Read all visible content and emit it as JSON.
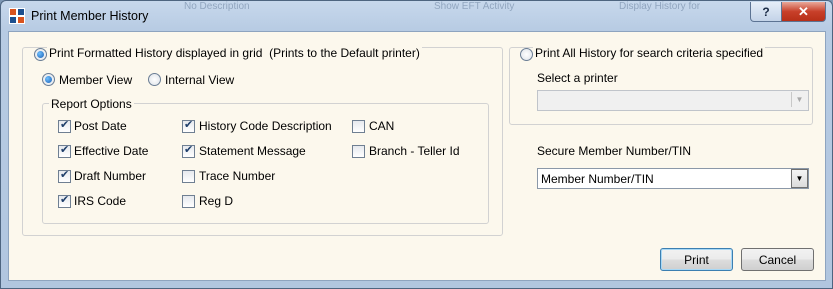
{
  "window": {
    "title": "Print Member History",
    "help_label": "?",
    "close_label": "✕",
    "background_ghost": [
      "No Description",
      "Show EFT Activity",
      "Display History for"
    ]
  },
  "formatted": {
    "radio_label": "Print Formatted History displayed in grid",
    "note": "(Prints to the Default printer)",
    "selected": true,
    "view_member_label": "Member View",
    "view_internal_label": "Internal View",
    "selected_view": "Member View"
  },
  "report_options": {
    "legend": "Report Options",
    "col1": [
      {
        "label": "Post Date",
        "checked": true
      },
      {
        "label": "Effective Date",
        "checked": true
      },
      {
        "label": "Draft Number",
        "checked": true
      },
      {
        "label": "IRS Code",
        "checked": true
      }
    ],
    "col2": [
      {
        "label": "History Code Description",
        "checked": true
      },
      {
        "label": "Statement Message",
        "checked": true
      },
      {
        "label": "Trace Number",
        "checked": false
      },
      {
        "label": "Reg D",
        "checked": false
      }
    ],
    "col3": [
      {
        "label": "CAN",
        "checked": false
      },
      {
        "label": "Branch - Teller Id",
        "checked": false
      }
    ]
  },
  "all_history": {
    "radio_label": "Print All History for search criteria specified",
    "selected": false,
    "printer_label": "Select a printer",
    "printer_value": ""
  },
  "secure": {
    "label": "Secure Member Number/TIN",
    "value": "Member Number/TIN"
  },
  "buttons": {
    "print": "Print",
    "cancel": "Cancel"
  }
}
